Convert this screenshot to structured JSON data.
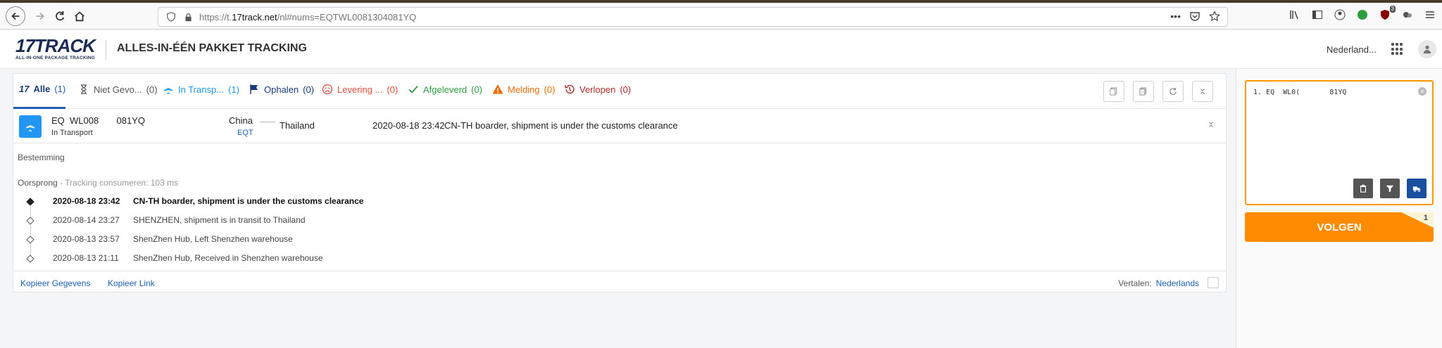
{
  "browser": {
    "url_prefix": "https://t.",
    "url_host": "17track.net",
    "url_suffix": "/nl#nums=EQTWL0081304081YQ",
    "url_more": "•••",
    "ext_badge": "3"
  },
  "header": {
    "logo_main": "17TRACK",
    "logo_sub": "ALL-IN-ONE PACKAGE TRACKING",
    "title": "ALLES-IN-ÉÉN PAKKET TRACKING",
    "language": "Nederland..."
  },
  "tabs": [
    {
      "label": "Alle",
      "count": "(1)",
      "icon": "17-logo-icon"
    },
    {
      "label": "Niet Gevo...",
      "count": "(0)",
      "icon": "hourglass-icon"
    },
    {
      "label": "In Transp...",
      "count": "(1)",
      "icon": "airplane-icon"
    },
    {
      "label": "Ophalen",
      "count": "(0)",
      "icon": "flag-icon"
    },
    {
      "label": "Levering ...",
      "count": "(0)",
      "icon": "sad-face-icon"
    },
    {
      "label": "Afgeleverd",
      "count": "(0)",
      "icon": "checkmark-icon"
    },
    {
      "label": "Melding",
      "count": "(0)",
      "icon": "warning-icon"
    },
    {
      "label": "Verlopen",
      "count": "(0)",
      "icon": "history-icon"
    }
  ],
  "shipment": {
    "number": "EQ  WL008       081YQ",
    "status": "In Transport",
    "origin": "China",
    "carrier": "EQT",
    "destination": "Thailand",
    "latest_time": "2020-08-18 23:42",
    "latest_event": "CN-TH boarder, shipment is under the customs clearance"
  },
  "details": {
    "destination_label": "Bestemming",
    "origin_label": "Oorsprong",
    "origin_sub": " - Tracking consumeren: 103 ms",
    "events": [
      {
        "time": "2020-08-18 23:42",
        "text": "CN-TH boarder, shipment is under the customs clearance"
      },
      {
        "time": "2020-08-14 23:27",
        "text": "SHENZHEN, shipment is in transit to Thailand"
      },
      {
        "time": "2020-08-13 23:57",
        "text": "ShenZhen Hub, Left Shenzhen warehouse"
      },
      {
        "time": "2020-08-13 21:11",
        "text": "ShenZhen Hub, Received in Shenzhen warehouse"
      }
    ]
  },
  "footer": {
    "copy_details": "Kopieer Gegevens",
    "copy_link": "Kopieer Link",
    "translate_label": "Vertalen:",
    "translate_lang": "Nederlands"
  },
  "sidebar": {
    "input_text": "1. EQ  WL0(       81YQ",
    "follow_label": "VOLGEN",
    "follow_count": "1"
  },
  "colors": {
    "accent": "#ff8c00",
    "primary": "#1a5fb4",
    "transit": "#2196f3"
  }
}
